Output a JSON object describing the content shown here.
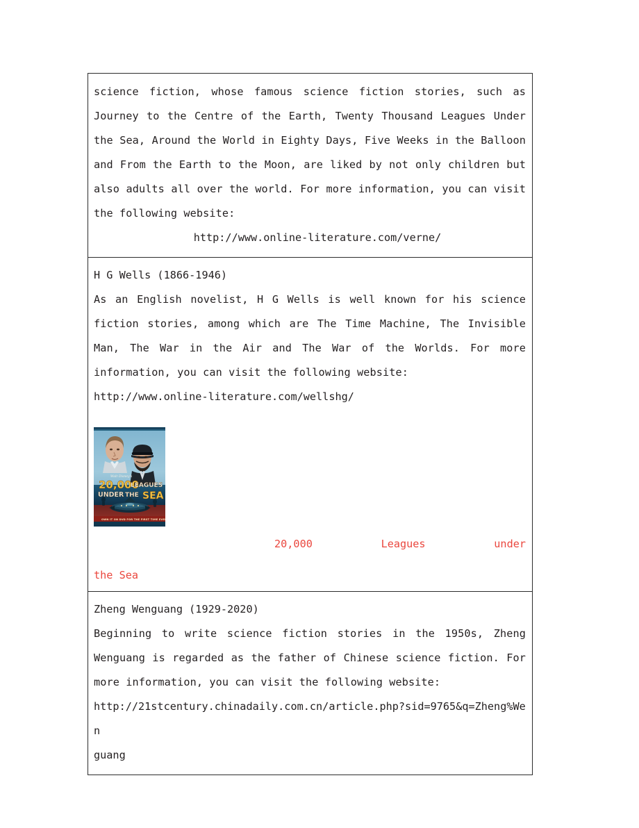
{
  "document": {
    "sections": [
      {
        "id": "jules-verne-continued",
        "body_text": "science fiction, whose famous science fiction stories, such as Journey to the Centre of the Earth, Twenty Thousand Leagues Under the Sea, Around the World in Eighty Days, Five Weeks in the Balloon and From the Earth to the Moon, are liked by not only children but also adults all over the world. For more information, you can visit the following website:",
        "url": "http://www.online-literature.com/verne/"
      },
      {
        "id": "h-g-wells",
        "heading": "H G Wells (1866-1946)",
        "body_text": "As an English novelist, H G Wells is well known for his science fiction stories, among which are The Time Machine, The Invisible Man, The War in the Air and The War of the Worlds. For more information, you can visit the following website:",
        "url": "http://www.online-literature.com/wellshg/",
        "image": {
          "name": "20000-leagues-under-the-sea-poster",
          "title_line_1": "20,000",
          "title_line_1b": "LEAGUES",
          "title_line_2a": "UNDER",
          "title_line_2b": "THE",
          "title_line_2c": "SEA",
          "studio_credit": "Walt Disney's",
          "bottom_banner": "OWN IT ON DVD FOR THE FIRST TIME EVER",
          "colors": {
            "sky": "#6fa7c4",
            "sea_deep": "#123a54",
            "sea_red": "#9e2b20",
            "title_gold": "#f5c842",
            "title_white": "#f2efe6"
          }
        },
        "caption": {
          "line1": "20,000   Leagues   under",
          "line2": "the Sea",
          "color": "#ea473e"
        }
      },
      {
        "id": "zheng-wenguang",
        "heading": "Zheng Wenguang (1929-2020)",
        "body_text": "Beginning to write science fiction stories in the 1950s, Zheng Wenguang is regarded as the father of Chinese science fiction. For more information, you can visit the following website:",
        "url_part_1": "http://21stcentury.chinadaily.com.cn/article.php?sid=9765&q=Zheng%Wen",
        "url_part_2": "guang"
      }
    ]
  }
}
